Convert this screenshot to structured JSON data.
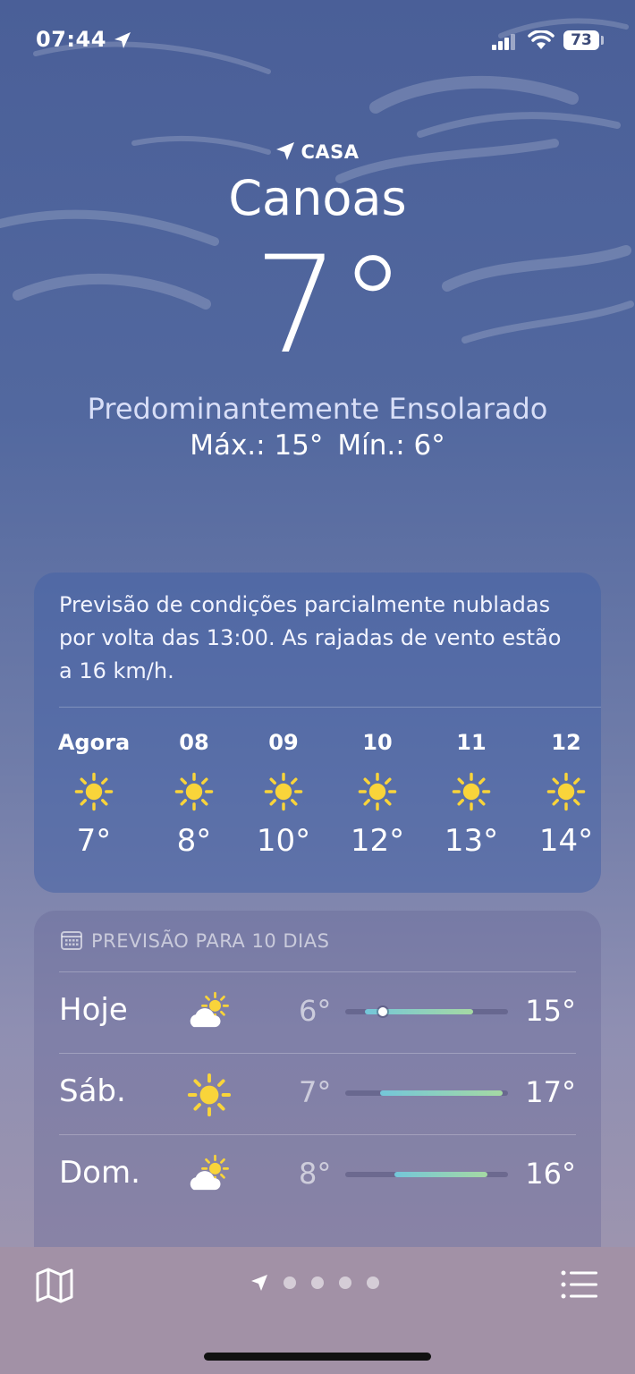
{
  "status_bar": {
    "time": "07:44",
    "battery": "73"
  },
  "header": {
    "location_label": "CASA",
    "city": "Canoas",
    "temperature": "7°",
    "condition": "Predominantemente Ensolarado",
    "high": "Máx.: 15°",
    "low": "Mín.: 6°"
  },
  "hourly": {
    "summary": "Previsão de condições parcialmente nubladas por volta das 13:00. As rajadas de vento estão a 16 km/h.",
    "hours": [
      {
        "label": "Agora",
        "icon": "sun-icon",
        "temp": "7°"
      },
      {
        "label": "08",
        "icon": "sun-icon",
        "temp": "8°"
      },
      {
        "label": "09",
        "icon": "sun-icon",
        "temp": "10°"
      },
      {
        "label": "10",
        "icon": "sun-icon",
        "temp": "12°"
      },
      {
        "label": "11",
        "icon": "sun-icon",
        "temp": "13°"
      },
      {
        "label": "12",
        "icon": "sun-icon",
        "temp": "14°"
      }
    ]
  },
  "daily": {
    "title": "PREVISÃO PARA 10 DIAS",
    "range_min": 6,
    "range_max": 17,
    "days": [
      {
        "day": "Hoje",
        "icon": "partly-cloudy-icon",
        "low": "6°",
        "high": "15°",
        "low_value": 6,
        "high_value": 15,
        "current_value": 7
      },
      {
        "day": "Sáb.",
        "icon": "sun-icon",
        "low": "7°",
        "high": "17°",
        "low_value": 7,
        "high_value": 17
      },
      {
        "day": "Dom.",
        "icon": "partly-cloudy-icon",
        "low": "8°",
        "high": "16°",
        "low_value": 8,
        "high_value": 16
      }
    ]
  },
  "colors": {
    "sun": "#f9d43a",
    "range_start": "#74c6d9",
    "range_end": "#a5d9a3"
  },
  "pager": {
    "pages": 4
  }
}
